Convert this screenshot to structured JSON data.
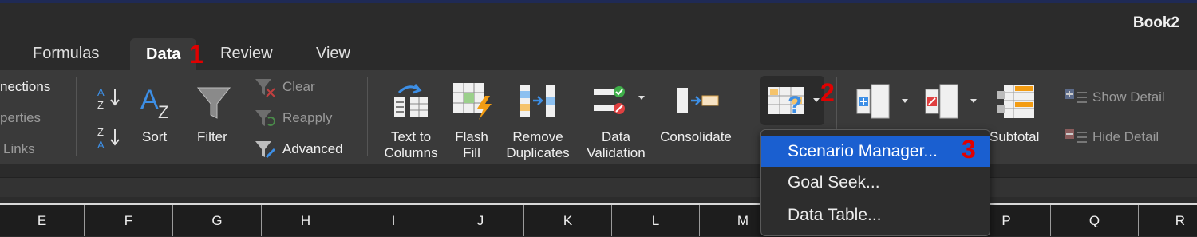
{
  "window": {
    "title": "Book2"
  },
  "tabs": [
    {
      "label": "Formulas"
    },
    {
      "label": "Data"
    },
    {
      "label": "Review"
    },
    {
      "label": "View"
    }
  ],
  "markers": {
    "one": "1",
    "two": "2",
    "three": "3"
  },
  "ribbon": {
    "connections": {
      "connections": "nections",
      "properties": "perties",
      "links": "Links"
    },
    "sort_filter": {
      "sort": "Sort",
      "filter": "Filter",
      "clear": "Clear",
      "reapply": "Reapply",
      "advanced": "Advanced"
    },
    "tools": {
      "text_to_columns_1": "Text to",
      "text_to_columns_2": "Columns",
      "flash_fill_1": "Flash",
      "flash_fill_2": "Fill",
      "remove_duplicates_1": "Remove",
      "remove_duplicates_2": "Duplicates",
      "data_validation_1": "Data",
      "data_validation_2": "Validation",
      "consolidate": "Consolidate"
    },
    "outline": {
      "subtotal": "Subtotal",
      "show_detail": "Show Detail",
      "hide_detail": "Hide Detail"
    }
  },
  "whatif_menu": {
    "items": [
      "Scenario Manager...",
      "Goal Seek...",
      "Data Table..."
    ],
    "selected": 0
  },
  "columns": [
    "E",
    "F",
    "G",
    "H",
    "I",
    "J",
    "K",
    "L",
    "M",
    "P",
    "Q",
    "R"
  ],
  "colors": {
    "accent": "#1a5fd0",
    "marker": "#e10000",
    "ribbon": "#3a3a3a"
  }
}
